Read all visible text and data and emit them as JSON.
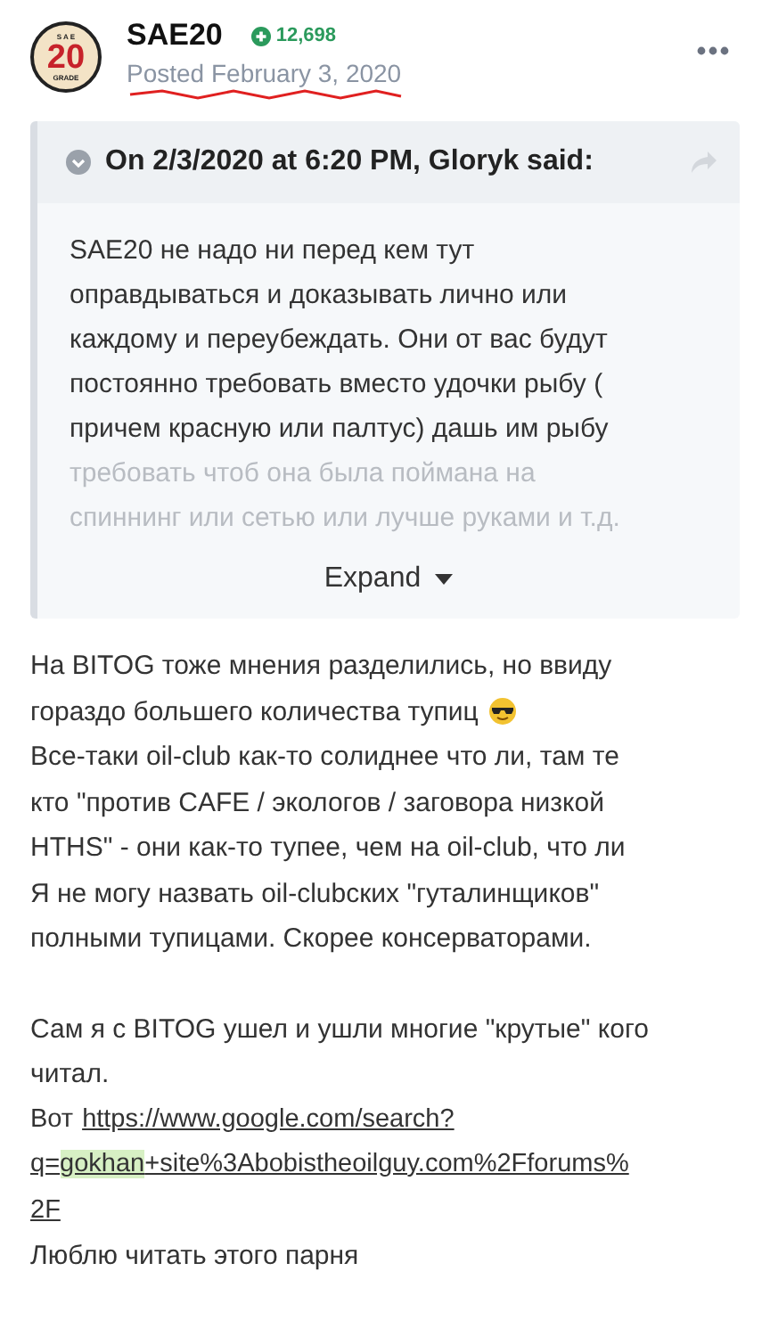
{
  "post": {
    "author": "SAE20",
    "reputation": "12,698",
    "posted": "Posted February 3, 2020",
    "avatar_text": [
      "S A E",
      "20",
      "GRADE"
    ]
  },
  "quote": {
    "header": "On 2/3/2020 at 6:20 PM, Gloryk said:",
    "lines": [
      {
        "text": "SAE20 не надо ни перед кем тут",
        "faded": false
      },
      {
        "text": "оправдываться и доказывать лично или",
        "faded": false
      },
      {
        "text": "каждому и переубеждать. Они от вас будут",
        "faded": false
      },
      {
        "text": "постоянно требовать вместо удочки рыбу (",
        "faded": false
      },
      {
        "text": "причем красную или палтус) дашь им рыбу",
        "faded": false
      },
      {
        "text": "требовать чтоб она была поймана на",
        "faded": true
      },
      {
        "text": "спиннинг или сетью или лучше руками и т.д.",
        "faded": true
      }
    ],
    "expand": "Expand"
  },
  "body": [
    {
      "kind": "text",
      "text": "На BITOG тоже мнения разделились, но ввиду"
    },
    {
      "kind": "emoji_text",
      "text": "гораздо большего количества тупиц"
    },
    {
      "kind": "text",
      "text": "Все-таки oil-club как-то солиднее что ли, там те"
    },
    {
      "kind": "text",
      "text": "кто \"против CAFE / экологов / заговора низкой"
    },
    {
      "kind": "text",
      "text": "HTHS\" - они как-то тупее, чем на oil-club, что ли"
    },
    {
      "kind": "text",
      "text": "Я не могу назвать oil-clubских \"гуталинщиков\""
    },
    {
      "kind": "text",
      "text": "полными тупицами. Скорее консерваторами."
    },
    {
      "kind": "gap"
    },
    {
      "kind": "text",
      "text": "Сам я с BITOG ушел и ушли многие \"крутые\" кого"
    },
    {
      "kind": "text",
      "text": "читал."
    },
    {
      "kind": "link",
      "prefix": "Вот",
      "before": "https://www.google.com/search?"
    },
    {
      "kind": "link",
      "before": "q=",
      "highlight": "gokhan",
      "after": "+site%3Abobistheoilguy.com%2Fforums%"
    },
    {
      "kind": "link",
      "before": "2F"
    },
    {
      "kind": "text",
      "text": "Люблю читать этого парня"
    }
  ]
}
